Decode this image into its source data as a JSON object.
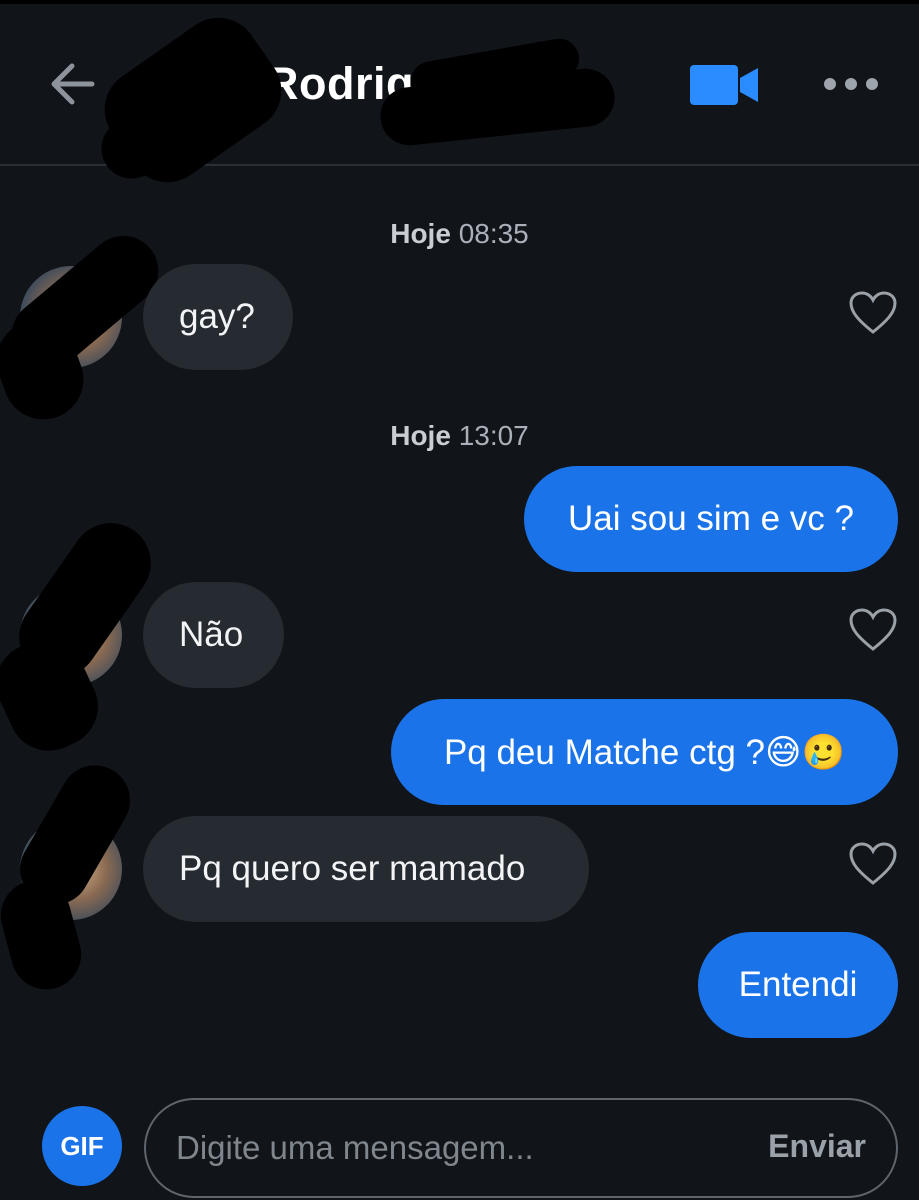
{
  "header": {
    "contact_name": "Rodrig",
    "icons": {
      "back": "arrow-left-icon",
      "video": "video-camera-icon",
      "more": "more-dots-icon"
    },
    "accent_color": "#1a73e8"
  },
  "conversation": {
    "timestamps": [
      {
        "day": "Hoje",
        "time": "08:35"
      },
      {
        "day": "Hoje",
        "time": "13:07"
      }
    ],
    "messages": [
      {
        "direction": "incoming",
        "text": "gay?"
      },
      {
        "direction": "outgoing",
        "text": "Uai sou sim e vc ?"
      },
      {
        "direction": "incoming",
        "text": "Não"
      },
      {
        "direction": "outgoing",
        "text": "Pq deu Matche ctg ?😅🥲"
      },
      {
        "direction": "incoming",
        "text": "Pq quero ser mamado"
      },
      {
        "direction": "outgoing",
        "text": "Entendi"
      }
    ]
  },
  "composer": {
    "gif_label": "GIF",
    "placeholder": "Digite uma mensagem...",
    "send_label": "Enviar"
  }
}
